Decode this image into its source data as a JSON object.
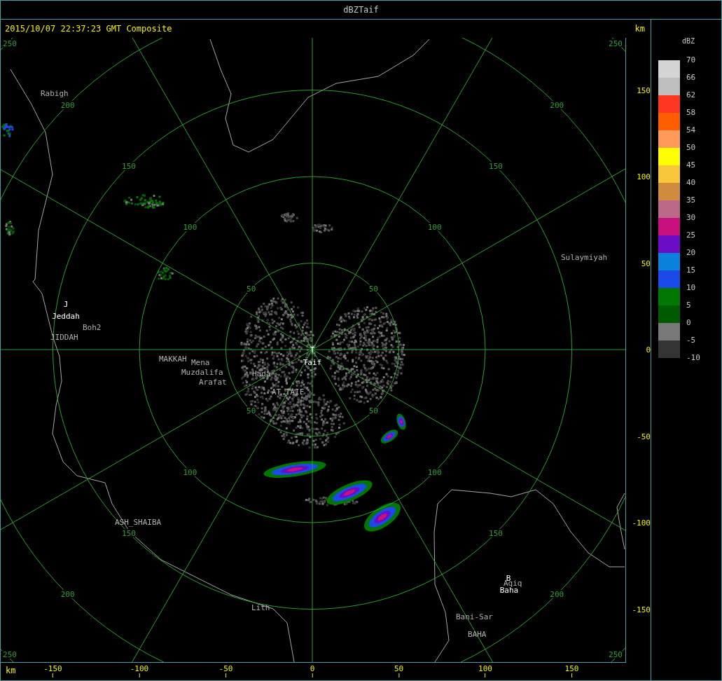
{
  "window": {
    "title": "dBZTaif"
  },
  "header": {
    "timestamp": "2015/10/07 22:37:23 GMT Composite",
    "unit": "km"
  },
  "rings": [
    {
      "labels": [
        "50",
        "50",
        "50",
        "50"
      ]
    },
    {
      "labels": [
        "100",
        "100",
        "100",
        "100"
      ]
    },
    {
      "labels": [
        "150",
        "150",
        "150",
        "150"
      ]
    },
    {
      "labels": [
        "200",
        "200",
        "200",
        "200"
      ]
    },
    {
      "labels": [
        "250",
        "250",
        "250",
        "250"
      ]
    }
  ],
  "places": [
    {
      "name": "Rabigh",
      "kind": "place"
    },
    {
      "name": "J",
      "kind": "station"
    },
    {
      "name": "Jeddah",
      "kind": "station"
    },
    {
      "name": "Boh2",
      "kind": "place"
    },
    {
      "name": "JIDDAH",
      "kind": "place"
    },
    {
      "name": "MAKKAH",
      "kind": "place"
    },
    {
      "name": "Mena",
      "kind": "place"
    },
    {
      "name": "Muzdalifa",
      "kind": "place"
    },
    {
      "name": "Arafat",
      "kind": "place"
    },
    {
      "name": "Hada",
      "kind": "place"
    },
    {
      "name": "T",
      "kind": "station"
    },
    {
      "name": "Taif",
      "kind": "station"
    },
    {
      "name": "AT_TAIF",
      "kind": "place"
    },
    {
      "name": "Sulaymiyah",
      "kind": "place"
    },
    {
      "name": "ASH_SHAIBA",
      "kind": "place"
    },
    {
      "name": "Lith",
      "kind": "place"
    },
    {
      "name": "B",
      "kind": "station"
    },
    {
      "name": "Aqiq",
      "kind": "place"
    },
    {
      "name": "Baha",
      "kind": "station"
    },
    {
      "name": "Bani-Sar",
      "kind": "place"
    },
    {
      "name": "BAHA",
      "kind": "place"
    }
  ],
  "y_axis": {
    "ticks": [
      "150",
      "100",
      "50",
      "0",
      "-50",
      "-100",
      "-150"
    ]
  },
  "x_axis": {
    "unit": "km",
    "ticks": [
      "-150",
      "-100",
      "-50",
      "0",
      "50",
      "100",
      "150"
    ]
  },
  "legend": {
    "title": "dBZ",
    "levels": [
      {
        "label": "70",
        "color": "#d4d4d4"
      },
      {
        "label": "66",
        "color": "#bebebe"
      },
      {
        "label": "62",
        "color": "#ff3622"
      },
      {
        "label": "58",
        "color": "#ff5e00"
      },
      {
        "label": "54",
        "color": "#ff9a5a"
      },
      {
        "label": "50",
        "color": "#ffff00"
      },
      {
        "label": "45",
        "color": "#f9c73a"
      },
      {
        "label": "40",
        "color": "#d08b3e"
      },
      {
        "label": "35",
        "color": "#bc6889"
      },
      {
        "label": "30",
        "color": "#c8107f"
      },
      {
        "label": "25",
        "color": "#6b0dc4"
      },
      {
        "label": "20",
        "color": "#0a82dc"
      },
      {
        "label": "15",
        "color": "#1c4ae8"
      },
      {
        "label": "10",
        "color": "#007800"
      },
      {
        "label": "5",
        "color": "#005a00"
      },
      {
        "label": "0",
        "color": "#787878"
      },
      {
        "label": "-5",
        "color": "#353535"
      }
    ],
    "bottom_label": "-10"
  }
}
